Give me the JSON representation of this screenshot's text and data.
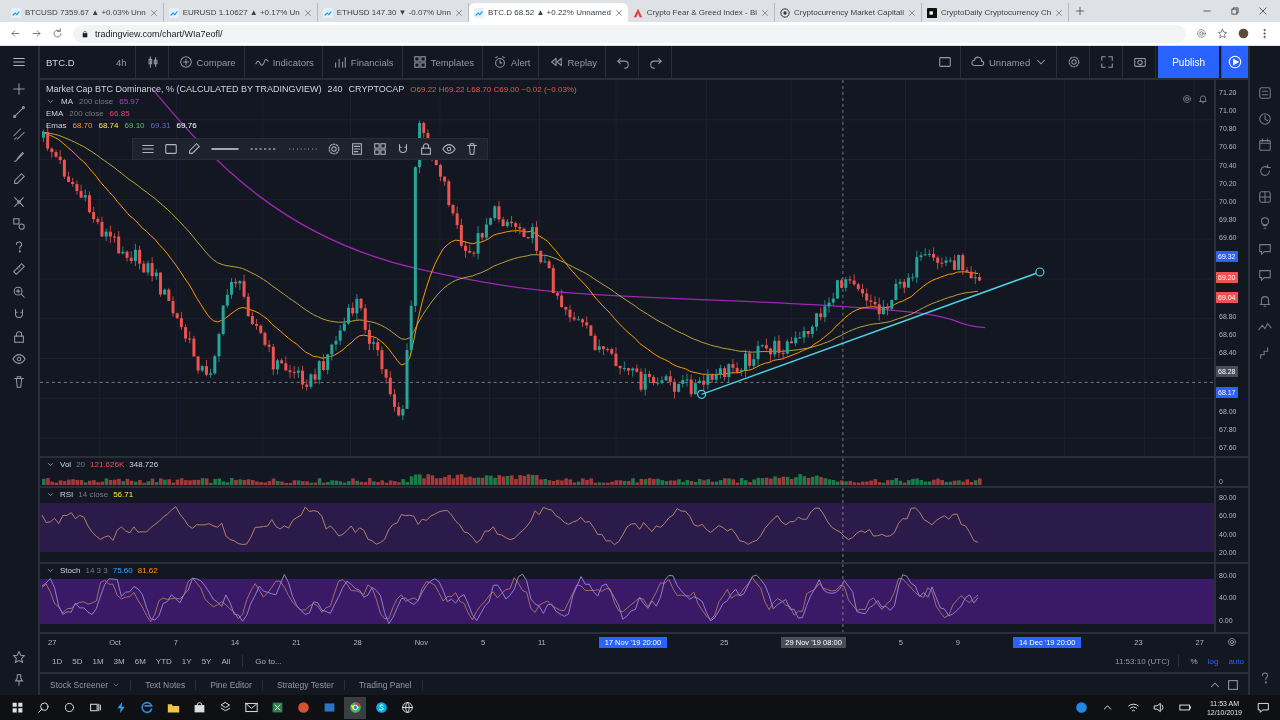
{
  "browser": {
    "tabs": [
      {
        "title": "BTCUSD 7359.67 ▲ +0.03% Unn",
        "kind": "tv",
        "selected": false
      },
      {
        "title": "EURUSD 1.10627 ▲ +0.17% Un",
        "kind": "tv",
        "selected": false
      },
      {
        "title": "ETHUSD 147.30 ▼ -0.07% Unn",
        "kind": "tv",
        "selected": false
      },
      {
        "title": "BTC.D 68.52 ▲ +0.22% Unnamed",
        "kind": "tv",
        "selected": true
      },
      {
        "title": "Crypto Fear & Greed Index - Bi",
        "kind": "alt",
        "selected": false
      },
      {
        "title": "Cryptocurrency Market Capitali",
        "kind": "globe",
        "selected": false
      },
      {
        "title": "CryptoDaily Cryptocurrency Ch",
        "kind": "dark",
        "selected": false
      }
    ],
    "url": "tradingview.com/chart/WIa7eofl/"
  },
  "toolbar": {
    "symbol": "BTC.D",
    "interval": "4h",
    "items": [
      {
        "label": "Compare",
        "kind": "compare"
      },
      {
        "label": "Indicators",
        "kind": "indicators"
      },
      {
        "label": "Financials",
        "kind": "financials"
      },
      {
        "label": "Templates",
        "kind": "templates"
      },
      {
        "label": "Alert",
        "kind": "alert"
      },
      {
        "label": "Replay",
        "kind": "replay"
      }
    ],
    "layout_name": "Unnamed",
    "publish": "Publish"
  },
  "legend": {
    "title": "Market Cap BTC Dominance, % (CALCULATED BY TRADINGVIEW)",
    "interval": "240",
    "exchange": "CRYPTOCAP",
    "ohlc": "O69.22 H69.22 L68.70 C69.00 −0.02 (−0.03%)",
    "indicators": [
      {
        "name": "MA",
        "params": "200 close",
        "values": [
          {
            "text": "65.97"
          }
        ]
      },
      {
        "name": "EMA",
        "params": "200 close",
        "values": [
          {
            "text": "66.85"
          }
        ]
      },
      {
        "name": "Emas",
        "values": [
          {
            "text": "68.70"
          },
          {
            "text": "68.74"
          },
          {
            "text": "69.10"
          },
          {
            "text": "69.31"
          },
          {
            "text": "69.76"
          }
        ]
      }
    ]
  },
  "price_axis": [
    {
      "kind": "tick",
      "label": "71.20"
    },
    {
      "kind": "tick",
      "label": "71.00"
    },
    {
      "kind": "tick",
      "label": "70.80"
    },
    {
      "kind": "tick",
      "label": "70.60"
    },
    {
      "kind": "tick",
      "label": "70.40"
    },
    {
      "kind": "tick",
      "label": "70.20"
    },
    {
      "kind": "tick",
      "label": "70.00"
    },
    {
      "kind": "tick",
      "label": "69.80"
    },
    {
      "kind": "tick",
      "label": "69.60"
    },
    {
      "kind": "badge",
      "label": "69.32",
      "color": "#2962ff"
    },
    {
      "kind": "badge",
      "label": "69.20",
      "color": "#ef5350"
    },
    {
      "kind": "badge",
      "label": "69.04",
      "color": "#ef5350"
    },
    {
      "kind": "tick",
      "label": "68.80"
    },
    {
      "kind": "tick",
      "label": "68.60"
    },
    {
      "kind": "tick",
      "label": "68.40"
    },
    {
      "kind": "badge",
      "label": "68.28",
      "color": "#4a4e5a"
    },
    {
      "kind": "badge",
      "label": "68.17",
      "color": "#2962ff"
    },
    {
      "kind": "tick",
      "label": "68.00"
    },
    {
      "kind": "tick",
      "label": "67.80"
    },
    {
      "kind": "tick",
      "label": "67.60"
    }
  ],
  "panes": [
    {
      "kind": "volume",
      "name": "Vol",
      "params": "20",
      "values": [
        {
          "text": "121.626K"
        },
        {
          "text": "348.726"
        }
      ],
      "axis": [
        "0"
      ]
    },
    {
      "kind": "rsi",
      "name": "RSI",
      "params": "14 close",
      "values": [
        {
          "text": "56.71"
        }
      ],
      "axis": [
        "80.00",
        "60.00",
        "40.00",
        "20.00"
      ]
    },
    {
      "kind": "stoch",
      "name": "Stoch",
      "params": "14 3 3",
      "values": [
        {
          "text": "75.60"
        },
        {
          "text": "81.62"
        }
      ],
      "axis": [
        "80.00",
        "40.00",
        "0.00"
      ]
    }
  ],
  "time_axis": [
    {
      "kind": "label",
      "text": "27"
    },
    {
      "kind": "label",
      "text": "Oct"
    },
    {
      "kind": "label",
      "text": "7"
    },
    {
      "kind": "label",
      "text": "14"
    },
    {
      "kind": "label",
      "text": "21"
    },
    {
      "kind": "label",
      "text": "28"
    },
    {
      "kind": "label",
      "text": "Nov"
    },
    {
      "kind": "label",
      "text": "5"
    },
    {
      "kind": "label",
      "text": "11"
    },
    {
      "kind": "marker",
      "text": "17 Nov '19  20:00"
    },
    {
      "kind": "label",
      "text": "25"
    },
    {
      "kind": "crosshair",
      "text": "29 Nov '19  08:00"
    },
    {
      "kind": "label",
      "text": "5"
    },
    {
      "kind": "label",
      "text": "9"
    },
    {
      "kind": "marker",
      "text": "14 Dec '19  20:00"
    },
    {
      "kind": "label",
      "text": "23"
    },
    {
      "kind": "label",
      "text": "27"
    }
  ],
  "range_bar": {
    "ranges": [
      "1D",
      "5D",
      "1M",
      "3M",
      "6M",
      "YTD",
      "1Y",
      "5Y",
      "All"
    ],
    "goto": "Go to...",
    "clock": "11:53:10 (UTC)",
    "options": [
      {
        "label": "%",
        "selected": false
      },
      {
        "label": "log",
        "selected": true
      },
      {
        "label": "auto",
        "selected": true
      }
    ]
  },
  "bottom_tabs": [
    "Stock Screener",
    "Text Notes",
    "Pine Editor",
    "Strategy Tester",
    "Trading Panel"
  ],
  "taskbar": {
    "time": "11:53 AM",
    "date": "12/10/2019"
  }
}
